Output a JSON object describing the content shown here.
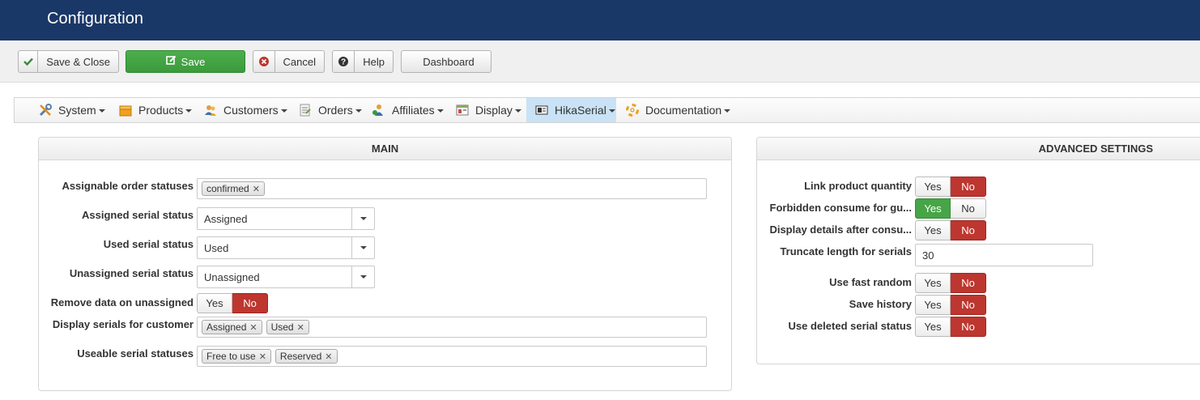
{
  "header": {
    "title": "Configuration"
  },
  "toolbar": {
    "save_close": "Save & Close",
    "save": "Save",
    "cancel": "Cancel",
    "help": "Help",
    "dashboard": "Dashboard"
  },
  "menu": {
    "items": [
      {
        "label": "System",
        "icon": "tools-icon"
      },
      {
        "label": "Products",
        "icon": "box-icon"
      },
      {
        "label": "Customers",
        "icon": "users-icon"
      },
      {
        "label": "Orders",
        "icon": "orders-icon"
      },
      {
        "label": "Affiliates",
        "icon": "affiliates-icon"
      },
      {
        "label": "Display",
        "icon": "display-icon"
      },
      {
        "label": "HikaSerial",
        "icon": "serial-icon",
        "active": true
      },
      {
        "label": "Documentation",
        "icon": "help-lifebuoy-icon"
      }
    ]
  },
  "main": {
    "title": "MAIN",
    "assignable_order_statuses": {
      "label": "Assignable order statuses",
      "tags": [
        "confirmed"
      ]
    },
    "assigned_serial_status": {
      "label": "Assigned serial status",
      "value": "Assigned"
    },
    "used_serial_status": {
      "label": "Used serial status",
      "value": "Used"
    },
    "unassigned_serial_status": {
      "label": "Unassigned serial status",
      "value": "Unassigned"
    },
    "remove_data_on_unassigned": {
      "label": "Remove data on unassigned",
      "yes": "Yes",
      "no": "No",
      "selected": "No"
    },
    "display_serials_for_customer": {
      "label": "Display serials for customer",
      "tags": [
        "Assigned",
        "Used"
      ]
    },
    "useable_serial_statuses": {
      "label": "Useable serial statuses",
      "tags": [
        "Free to use",
        "Reserved"
      ]
    }
  },
  "advanced": {
    "title": "ADVANCED SETTINGS",
    "link_product_quantity": {
      "label": "Link product quantity",
      "yes": "Yes",
      "no": "No",
      "selected": "No"
    },
    "forbidden_consume_for_guests": {
      "label": "Forbidden consume for gu...",
      "yes": "Yes",
      "no": "No",
      "selected": "Yes"
    },
    "display_details_after_consume": {
      "label": "Display details after consu...",
      "yes": "Yes",
      "no": "No",
      "selected": "No"
    },
    "truncate_length_for_serials": {
      "label": "Truncate length for serials",
      "value": "30"
    },
    "use_fast_random": {
      "label": "Use fast random",
      "yes": "Yes",
      "no": "No",
      "selected": "No"
    },
    "save_history": {
      "label": "Save history",
      "yes": "Yes",
      "no": "No",
      "selected": "No"
    },
    "use_deleted_serial_status": {
      "label": "Use deleted serial status",
      "yes": "Yes",
      "no": "No",
      "selected": "No"
    }
  },
  "colors": {
    "header_bg": "#1a3867",
    "save_green": "#46a546",
    "toggle_no_red": "#bd362f",
    "menu_active": "#c9e2f5"
  }
}
